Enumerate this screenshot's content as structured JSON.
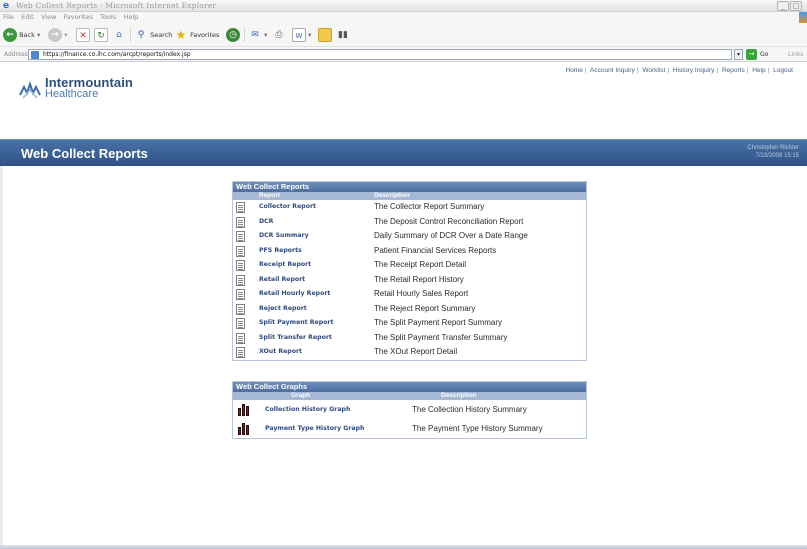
{
  "window": {
    "title": "Web Collect Reports - Microsoft Internet Explorer",
    "controls": [
      "_",
      "□"
    ]
  },
  "menubar": [
    "File",
    "Edit",
    "View",
    "Favorites",
    "Tools",
    "Help"
  ],
  "toolbar": {
    "back": "Back",
    "search": "Search",
    "favorites": "Favorites"
  },
  "address": {
    "label": "Address",
    "url": "https://finance.co.ihc.com/arcpt/reports/index.jsp",
    "go": "Go",
    "links": "Links"
  },
  "header": {
    "logo_line1": "Intermountain",
    "logo_line2": "Healthcare",
    "nav": [
      "Home",
      "Account Inquiry",
      "Worklist",
      "History Inquiry",
      "Reports",
      "Help",
      "Logout"
    ],
    "page_title": "Web Collect Reports",
    "user_name": "Christopher Richter",
    "timestamp": "7/23/2008 15:15"
  },
  "reports": {
    "title": "Web Collect Reports",
    "col_report": "Report",
    "col_description": "Description",
    "rows": [
      {
        "name": "Collector Report",
        "desc": "The Collector Report Summary"
      },
      {
        "name": "DCR",
        "desc": "The Deposit Control Reconciliation Report"
      },
      {
        "name": "DCR Summary",
        "desc": "Daily Summary of DCR Over a Date Range"
      },
      {
        "name": "PFS Reports",
        "desc": "Patient Financial Services Reports"
      },
      {
        "name": "Receipt Report",
        "desc": "The Receipt Report Detail"
      },
      {
        "name": "Retail Report",
        "desc": "The Retail Report History"
      },
      {
        "name": "Retail Hourly Report",
        "desc": "Retail Hourly Sales Report"
      },
      {
        "name": "Reject Report",
        "desc": "The Reject Report Summary"
      },
      {
        "name": "Split Payment Report",
        "desc": "The Split Payment Report Summary"
      },
      {
        "name": "Split Transfer Report",
        "desc": "The Split Payment Transfer Summary"
      },
      {
        "name": "XOut Report",
        "desc": "The XOut Report Detail"
      }
    ]
  },
  "graphs": {
    "title": "Web Collect Graphs",
    "col_graph": "Graph",
    "col_description": "Description",
    "rows": [
      {
        "name": "Collection History Graph",
        "desc": "The Collection History Summary"
      },
      {
        "name": "Payment Type History Graph",
        "desc": "The Payment Type History Summary"
      }
    ]
  },
  "colors": {
    "header_bar": "#3b5f94",
    "panel_head": "#5f80b0",
    "column_head": "#a5b8d5",
    "link": "#2f4a7d"
  }
}
